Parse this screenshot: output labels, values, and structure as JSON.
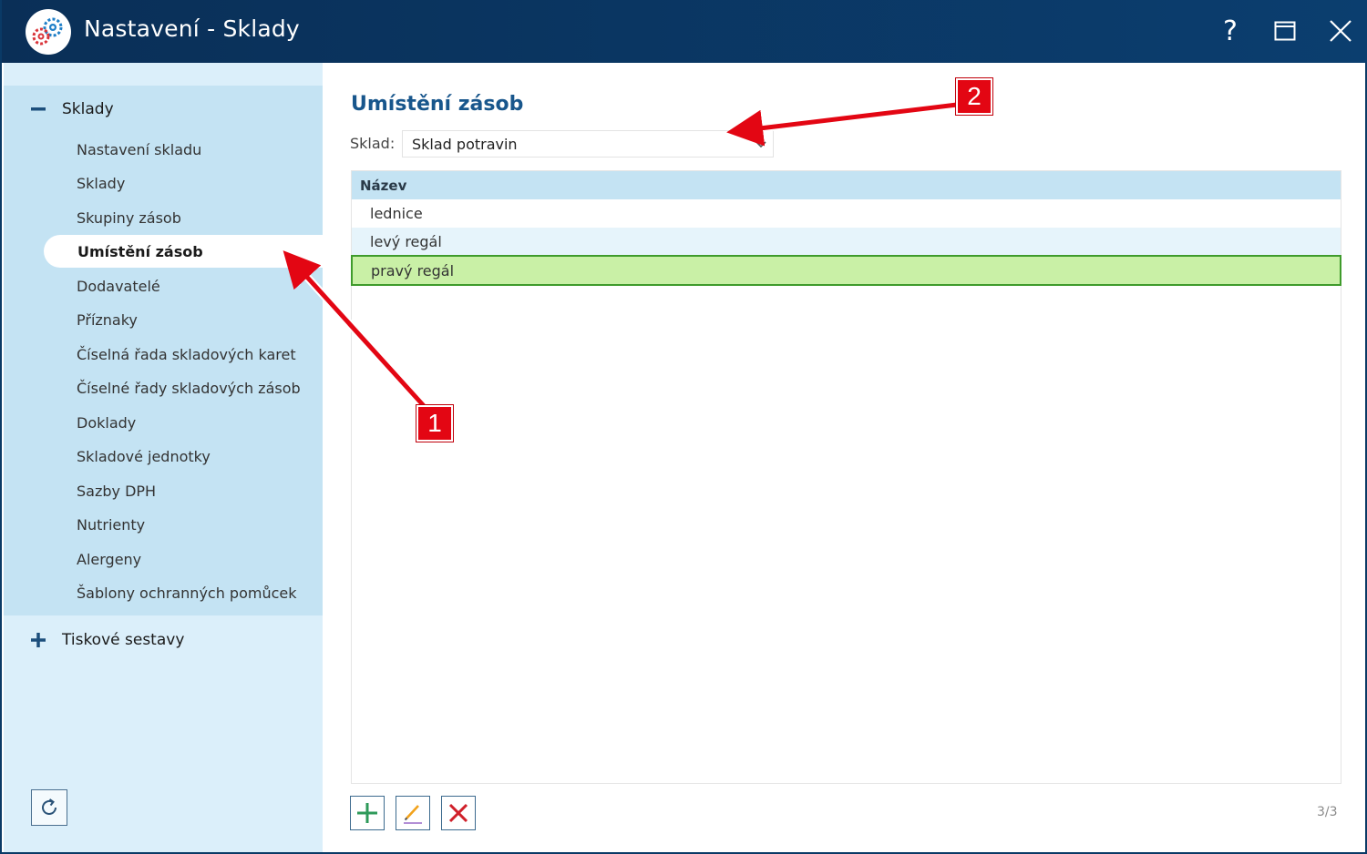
{
  "window": {
    "title": "Nastavení - Sklady",
    "help_label": "?"
  },
  "sidebar": {
    "groups": [
      {
        "label": "Sklady",
        "expanded": true,
        "items": [
          {
            "label": "Nastavení skladu"
          },
          {
            "label": "Sklady"
          },
          {
            "label": "Skupiny zásob"
          },
          {
            "label": "Umístění zásob",
            "active": true
          },
          {
            "label": "Dodavatelé"
          },
          {
            "label": "Příznaky"
          },
          {
            "label": "Číselná řada skladových karet"
          },
          {
            "label": "Číselné řady skladových zásob"
          },
          {
            "label": "Doklady"
          },
          {
            "label": "Skladové jednotky"
          },
          {
            "label": "Sazby DPH"
          },
          {
            "label": "Nutrienty"
          },
          {
            "label": "Alergeny"
          },
          {
            "label": "Šablony ochranných pomůcek"
          }
        ]
      },
      {
        "label": "Tiskové sestavy",
        "expanded": false
      }
    ]
  },
  "main": {
    "title": "Umístění zásob",
    "sklad_label": "Sklad:",
    "sklad_value": "Sklad potravin",
    "grid": {
      "column": "Název",
      "rows": [
        "lednice",
        "levý regál",
        "pravý regál"
      ],
      "selected_index": 2
    },
    "count": "3/3"
  },
  "annotations": {
    "badge1": "1",
    "badge2": "2"
  },
  "colors": {
    "titlebar": "#0b3e6f",
    "accent_title": "#18568c",
    "sidebar_bg": "#dbeffa",
    "sidebar_group_bg": "#c4e3f3",
    "selected_row": "#c9f0a6",
    "selected_border": "#3f9b2c",
    "annotation_red": "#e30613",
    "add_green": "#2e9a5a",
    "delete_red": "#d0202a"
  }
}
